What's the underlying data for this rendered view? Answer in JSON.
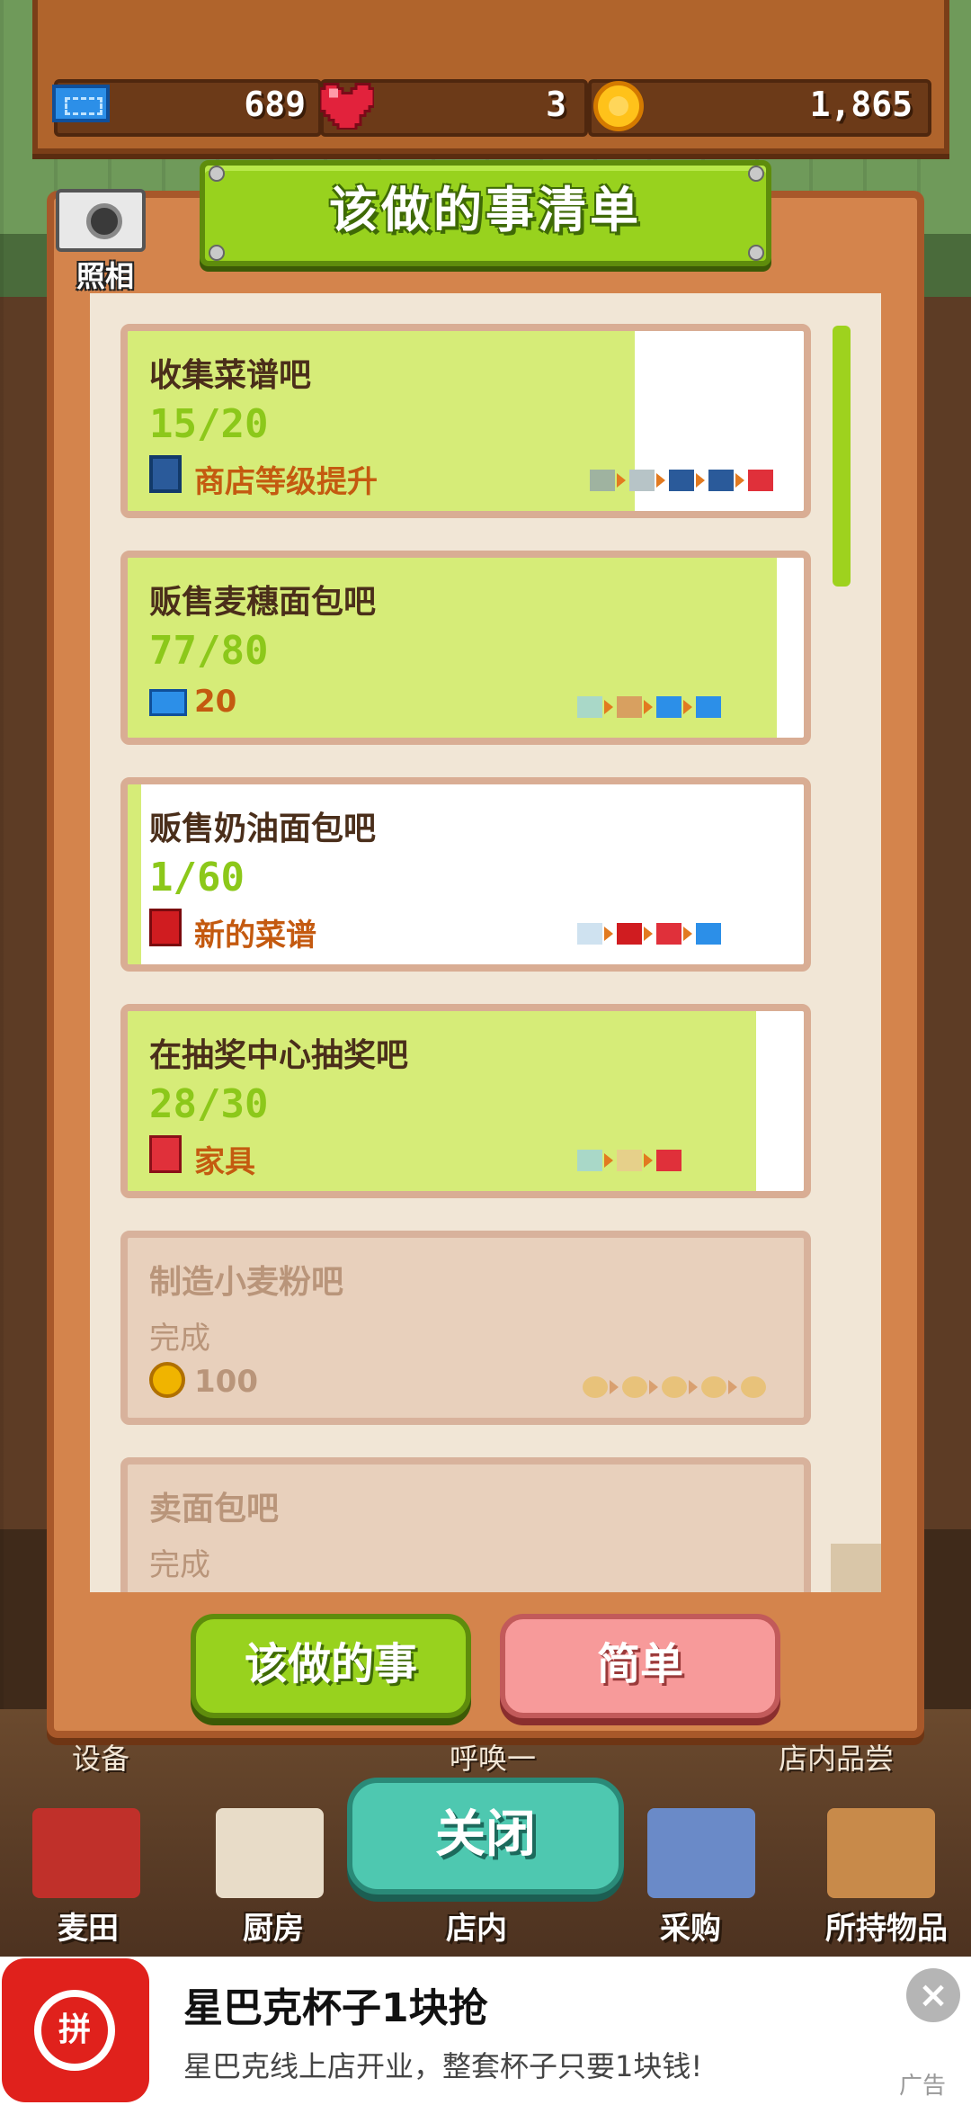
{
  "resources": {
    "tickets": "689",
    "hearts": "3",
    "coins": "1,865"
  },
  "camera": {
    "label": "照相"
  },
  "title": "该做的事清单",
  "quests": [
    {
      "title": "收集菜谱吧",
      "progress": "15/20",
      "reward": "商店等级提升",
      "reward_icon": "shop-icon",
      "fill": 0.75,
      "done": false
    },
    {
      "title": "贩售麦穗面包吧",
      "progress": "77/80",
      "reward": "20",
      "reward_icon": "ticket-icon",
      "fill": 0.96,
      "done": false
    },
    {
      "title": "贩售奶油面包吧",
      "progress": "1/60",
      "reward": "新的菜谱",
      "reward_icon": "recipe-book-icon",
      "fill": 0.02,
      "done": false
    },
    {
      "title": "在抽奖中心抽奖吧",
      "progress": "28/30",
      "reward": "家具",
      "reward_icon": "gift-icon",
      "fill": 0.93,
      "done": false
    },
    {
      "title": "制造小麦粉吧",
      "progress": "完成",
      "reward": "100",
      "reward_icon": "coin-stack-icon",
      "fill": 0,
      "done": true
    },
    {
      "title": "卖面包吧",
      "progress": "完成",
      "reward": "",
      "reward_icon": "",
      "fill": 0,
      "done": true
    }
  ],
  "tabs": {
    "todo": "该做的事",
    "easy": "简单"
  },
  "close_label": "关闭",
  "behind_labels": {
    "left": "设备",
    "center": "呼唤一",
    "right": "店内品尝"
  },
  "nav": [
    "麦田",
    "厨房",
    "店内",
    "采购",
    "所持物品"
  ],
  "ad": {
    "title": "星巴克杯子1块抢",
    "description": "星巴克线上店开业，整套杯子只要1块钱!",
    "tag": "广告",
    "logo_text": "拼",
    "close_glyph": "×"
  },
  "colors": {
    "accent_green": "#98d21e",
    "progress_green": "#8cc81a",
    "reward_orange": "#c45a10",
    "pink_tab": "#f79a9a",
    "close_teal": "#4ec8b0"
  }
}
